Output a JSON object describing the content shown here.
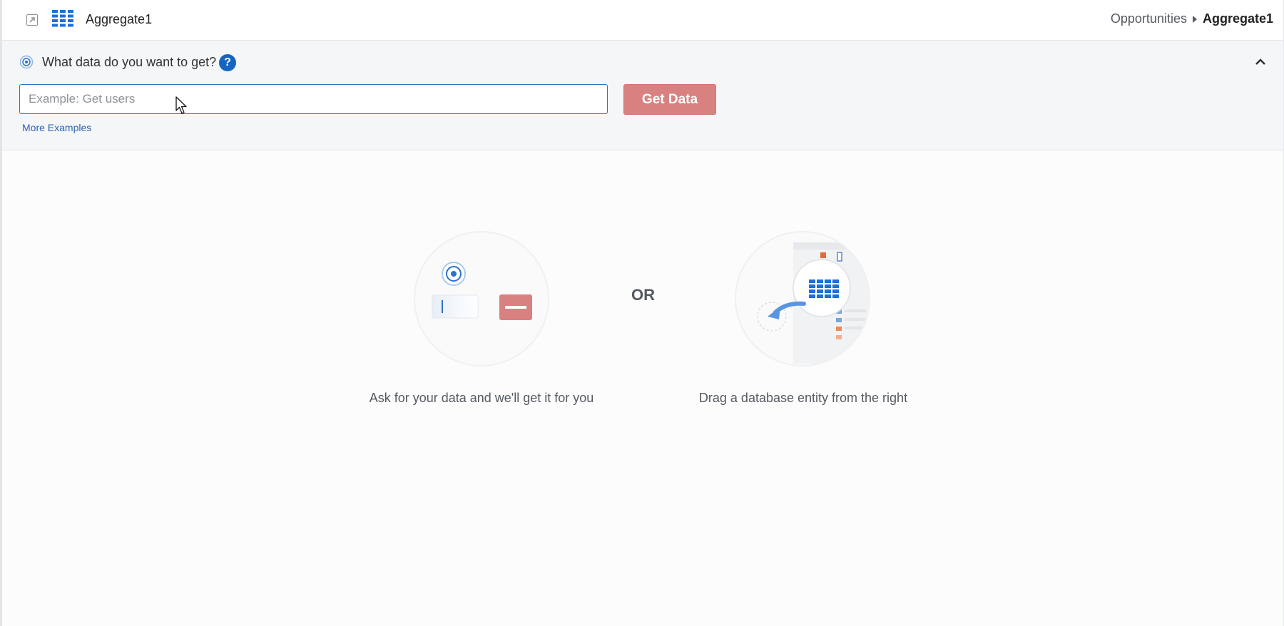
{
  "header": {
    "title": "Aggregate1",
    "breadcrumb": {
      "parent": "Opportunities",
      "current": "Aggregate1"
    },
    "grid_icon_color": "#1e6fd9"
  },
  "query": {
    "question": "What data do you want to get?",
    "help_glyph": "?",
    "input_placeholder": "Example: Get users",
    "input_value": "",
    "button_label": "Get Data",
    "more_examples_label": "More Examples",
    "button_color": "#d98080"
  },
  "empty_state": {
    "or_label": "OR",
    "left_caption": "Ask for your data and we'll get it for you",
    "right_caption": "Drag a database entity from the right"
  }
}
